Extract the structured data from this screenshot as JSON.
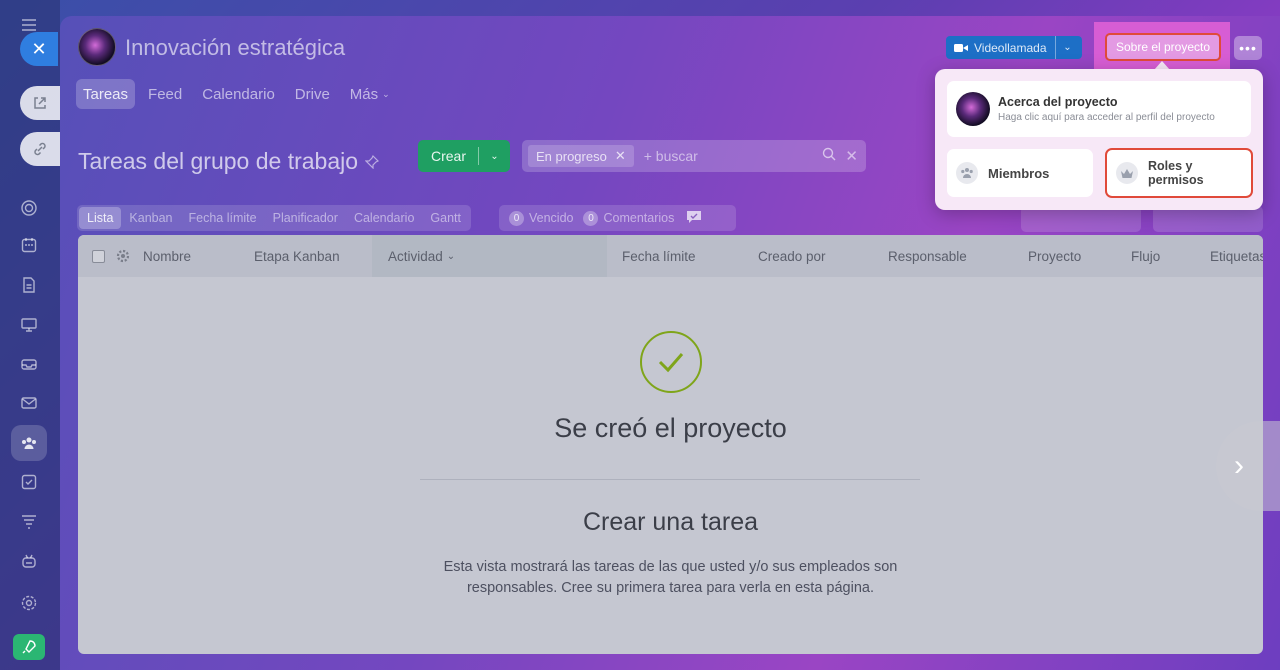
{
  "project": {
    "title": "Innovación estratégica"
  },
  "tabs": [
    {
      "label": "Tareas"
    },
    {
      "label": "Feed"
    },
    {
      "label": "Calendario"
    },
    {
      "label": "Drive"
    },
    {
      "label": "Más"
    }
  ],
  "header": {
    "video_label": "Videollamada",
    "about_label": "Sobre el proyecto",
    "more_label": "•••"
  },
  "toolbar": {
    "page_title": "Tareas del grupo de trabajo",
    "create_label": "Crear",
    "filter_chip": "En progreso",
    "search_placeholder": "+ buscar"
  },
  "views": [
    {
      "label": "Lista"
    },
    {
      "label": "Kanban"
    },
    {
      "label": "Fecha límite"
    },
    {
      "label": "Planificador"
    },
    {
      "label": "Calendario"
    },
    {
      "label": "Gantt"
    }
  ],
  "counters": [
    {
      "count": "0",
      "label": "Vencido"
    },
    {
      "count": "0",
      "label": "Comentarios"
    }
  ],
  "table": {
    "columns": [
      "Nombre",
      "Etapa Kanban",
      "Actividad",
      "Fecha límite",
      "Creado por",
      "Responsable",
      "Proyecto",
      "Flujo",
      "Etiquetas"
    ]
  },
  "empty_state": {
    "title": "Se creó el proyecto",
    "create_title": "Crear una tarea",
    "description_line1": "Esta vista mostrará las tareas de las que usted y/o sus empleados son",
    "description_line2": "responsables. Cree su primera tarea para verla en esta página."
  },
  "popup": {
    "about_title": "Acerca del proyecto",
    "about_subtitle": "Haga clic aquí para acceder al perfil del proyecto",
    "members_label": "Miembros",
    "roles_line1": "Roles y",
    "roles_line2": "permisos"
  },
  "colors": {
    "accent_blue": "#2f7ee0",
    "create_green": "#1f9f62",
    "highlight_red": "#e04a3a",
    "success_check": "#7fa51a"
  }
}
